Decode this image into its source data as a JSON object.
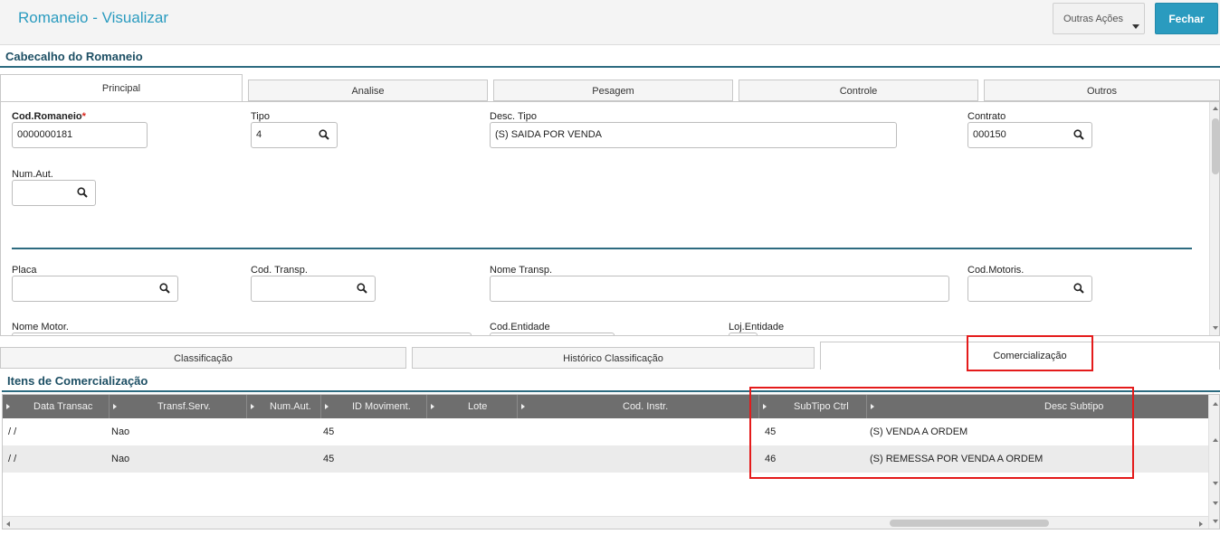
{
  "header": {
    "title": "Romaneio - Visualizar",
    "more_actions_label": "Outras Ações",
    "close_label": "Fechar"
  },
  "header_section": {
    "title": "Cabecalho do Romaneio",
    "tabs": [
      {
        "label": "Principal",
        "active": true
      },
      {
        "label": "Analise"
      },
      {
        "label": "Pesagem"
      },
      {
        "label": "Controle"
      },
      {
        "label": "Outros"
      }
    ]
  },
  "form": {
    "cod_romaneio": {
      "label": "Cod.Romaneio",
      "required_mark": "*",
      "value": "0000000181"
    },
    "tipo": {
      "label": "Tipo",
      "value": "4"
    },
    "desc_tipo": {
      "label": "Desc. Tipo",
      "value": "(S) SAIDA POR VENDA"
    },
    "contrato": {
      "label": "Contrato",
      "value": "000150"
    },
    "num_aut": {
      "label": "Num.Aut.",
      "value": ""
    },
    "placa": {
      "label": "Placa",
      "value": ""
    },
    "cod_transp": {
      "label": "Cod. Transp.",
      "value": ""
    },
    "nome_transp": {
      "label": "Nome Transp.",
      "value": ""
    },
    "cod_motoris": {
      "label": "Cod.Motoris.",
      "value": ""
    },
    "nome_motor": {
      "label": "Nome Motor.",
      "value": ""
    },
    "cod_entidade": {
      "label": "Cod.Entidade",
      "value": ""
    },
    "loj_entidade": {
      "label": "Loj.Entidade",
      "value": ""
    }
  },
  "lower_tabs": [
    {
      "label": "Classificação"
    },
    {
      "label": "Histórico Classificação"
    },
    {
      "label": "Comercialização",
      "active": true
    }
  ],
  "items_section": {
    "title": "Itens de Comercialização",
    "columns": [
      "Data Transac",
      "Transf.Serv.",
      "Num.Aut.",
      "ID Moviment.",
      "Lote",
      "Cod. Instr.",
      "SubTipo Ctrl",
      "Desc Subtipo"
    ],
    "rows": [
      {
        "data_transac": " /  /",
        "transf_serv": "Nao",
        "num_aut": "",
        "id_moviment": "45",
        "lote": "",
        "cod_instr": "",
        "subtipo_ctrl": "45",
        "desc_subtipo": "(S) VENDA A ORDEM"
      },
      {
        "data_transac": " /  /",
        "transf_serv": "Nao",
        "num_aut": "",
        "id_moviment": "45",
        "lote": "",
        "cod_instr": "",
        "subtipo_ctrl": "46",
        "desc_subtipo": "(S) REMESSA POR VENDA A ORDEM"
      }
    ]
  },
  "icons": {
    "search": "search-icon",
    "dropdown": "chevron-down-icon",
    "sort": "sort-arrow-icon"
  },
  "colors": {
    "accent": "#2a9bbf",
    "section_rule": "#2d6b80",
    "highlight": "#e41b1b",
    "grid_header": "#6e6e6e"
  }
}
